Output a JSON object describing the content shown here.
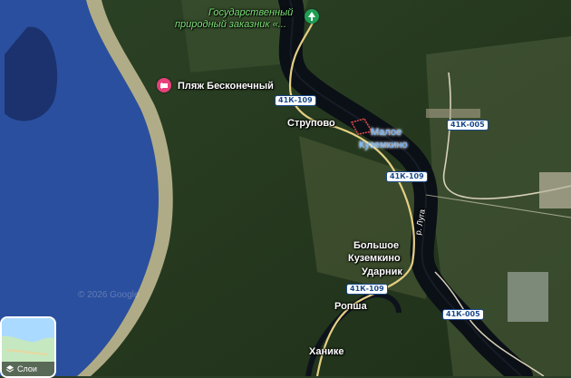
{
  "map": {
    "labels": {
      "reserve_line1": "Государственный",
      "reserve_line2": "природный заказник «...",
      "beach": "Пляж Бесконечный",
      "strupovo": "Струпово",
      "maloe_line1": "Малое",
      "maloe_line2": "Куземкино",
      "bolshoe_line1": "Большое",
      "bolshoe_line2": "Куземкино",
      "udarnik": "Ударник",
      "ropsha": "Ропша",
      "khanike": "Ханике",
      "river": "р. Луга"
    },
    "roads": {
      "r1": "41К-109",
      "r2": "41К-109",
      "r3": "41К-109",
      "r4": "41К-005",
      "r5": "41К-005"
    },
    "copyright": "© 2026 Google",
    "icons": {
      "reserve": "tree-icon",
      "beach": "beach-icon",
      "layers": "layers-icon"
    },
    "colors": {
      "river": "#0b0f16",
      "sea": "#2a4f9e",
      "forest": "#25391f",
      "field": "#4a5a35",
      "shield_text": "#1a4a8a"
    }
  },
  "controls": {
    "layers_label": "Слои"
  }
}
